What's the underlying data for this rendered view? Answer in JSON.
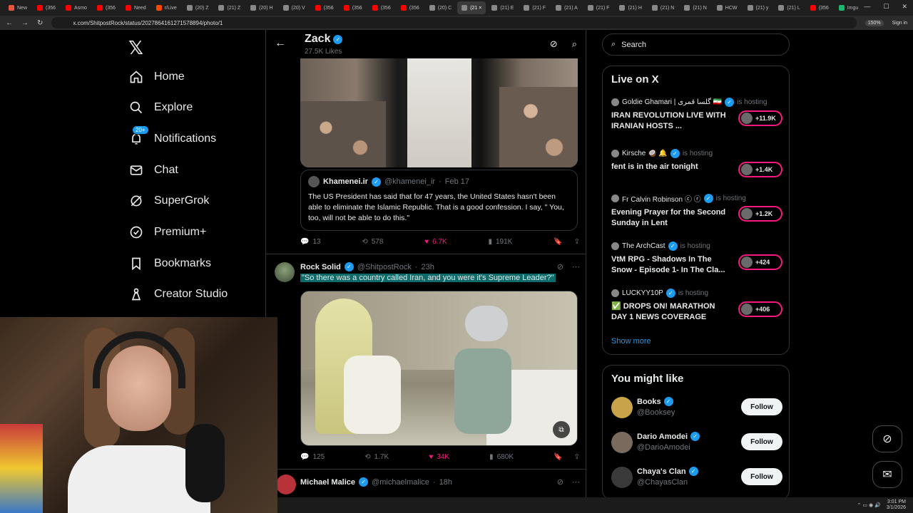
{
  "browser": {
    "tabs": [
      {
        "label": "New",
        "color": "#e8553a"
      },
      {
        "label": "(356",
        "color": "#ff0000"
      },
      {
        "label": "Asmo",
        "color": "#ff0000"
      },
      {
        "label": "(356",
        "color": "#ff0000"
      },
      {
        "label": "Need",
        "color": "#ff0000"
      },
      {
        "label": "r/Live",
        "color": "#ff4500"
      },
      {
        "label": "(20) Z",
        "color": "#888888"
      },
      {
        "label": "(21) Z",
        "color": "#888888"
      },
      {
        "label": "(20) H",
        "color": "#888888"
      },
      {
        "label": "(20) V",
        "color": "#888888"
      },
      {
        "label": "(356",
        "color": "#ff0000"
      },
      {
        "label": "(356",
        "color": "#ff0000"
      },
      {
        "label": "(356",
        "color": "#ff0000"
      },
      {
        "label": "(356",
        "color": "#ff0000"
      },
      {
        "label": "(20) C",
        "color": "#888888"
      },
      {
        "label": "(21 ×",
        "color": "#888888",
        "active": true
      },
      {
        "label": "(21) E",
        "color": "#888888"
      },
      {
        "label": "(21) F",
        "color": "#888888"
      },
      {
        "label": "(21) A",
        "color": "#888888"
      },
      {
        "label": "(21) F",
        "color": "#888888"
      },
      {
        "label": "(21) H",
        "color": "#888888"
      },
      {
        "label": "(21) N",
        "color": "#888888"
      },
      {
        "label": "(21) N",
        "color": "#888888"
      },
      {
        "label": "HCW",
        "color": "#888888"
      },
      {
        "label": "(21) y",
        "color": "#888888"
      },
      {
        "label": "(21) L",
        "color": "#888888"
      },
      {
        "label": "(356",
        "color": "#ff0000"
      },
      {
        "label": "Imgu",
        "color": "#1bb76e"
      }
    ],
    "url": "x.com/ShitpostRock/status/2027864161271578894/photo/1",
    "zoom": "150%",
    "signin": "Sign in"
  },
  "nav": {
    "items": [
      {
        "label": "Home",
        "icon": "home-icon"
      },
      {
        "label": "Explore",
        "icon": "search-icon"
      },
      {
        "label": "Notifications",
        "icon": "bell-icon",
        "badge": "20+"
      },
      {
        "label": "Chat",
        "icon": "mail-icon"
      },
      {
        "label": "SuperGrok",
        "icon": "grok-icon"
      },
      {
        "label": "Premium+",
        "icon": "premium-icon"
      },
      {
        "label": "Bookmarks",
        "icon": "bookmark-icon"
      },
      {
        "label": "Creator Studio",
        "icon": "creator-icon"
      }
    ]
  },
  "header": {
    "name": "Zack",
    "likes": "27.5K Likes"
  },
  "quote": {
    "name": "Khamenei.ir",
    "handle": "@khamenei_ir",
    "date": "Feb 17",
    "text": "The US President has said that for 47 years, the United States hasn't been able to eliminate the Islamic Republic. That is a good confession. I say, \" You, too, will not be able to do this.\""
  },
  "post1_actions": {
    "replies": "13",
    "reposts": "578",
    "likes": "6.7K",
    "views": "191K"
  },
  "post2": {
    "name": "Rock Solid",
    "handle": "@ShitpostRock",
    "time": "23h",
    "text": "\"So there was a country called Iran, and you were it's Supreme Leader?\""
  },
  "post2_actions": {
    "replies": "125",
    "reposts": "1.7K",
    "likes": "34K",
    "views": "680K"
  },
  "post3": {
    "name": "Michael Malice",
    "handle": "@michaelmalice",
    "time": "18h"
  },
  "search": {
    "placeholder": "Search"
  },
  "live": {
    "title": "Live on X",
    "items": [
      {
        "host": "Goldie Ghamari | گلسا قمری 🇮🇷",
        "hosting": "is hosting",
        "title": "IRAN REVOLUTION LIVE WITH IRANIAN HOSTS ...",
        "count": "+11.9K"
      },
      {
        "host": "Kirsche 🥥 🔔",
        "hosting": "is hosting",
        "title": "fent is in the air tonight",
        "count": "+1.4K"
      },
      {
        "host": "Fr Calvin Robinson ⓒ ⓡ",
        "hosting": "is hosting",
        "title": "Evening Prayer for the Second Sunday in Lent",
        "count": "+1.2K"
      },
      {
        "host": "The ArchCast",
        "hosting": "is hosting",
        "title": "VtM RPG - Shadows In The Snow - Episode 1- In The Cla...",
        "count": "+424"
      },
      {
        "host": "LUCKYY10P",
        "hosting": "is hosting",
        "title": "✅ DROPS ON! MARATHON DAY 1 NEWS COVERAGE",
        "count": "+406"
      }
    ],
    "show_more": "Show more"
  },
  "suggest": {
    "title": "You might like",
    "items": [
      {
        "name": "Books",
        "handle": "@Booksey",
        "button": "Follow",
        "color": "#c9a34a"
      },
      {
        "name": "Dario Amodei",
        "handle": "@DarioAmodei",
        "button": "Follow",
        "color": "#7a6a5e"
      },
      {
        "name": "Chaya's Clan",
        "handle": "@ChayasClan",
        "button": "Follow",
        "color": "#3a3a3a"
      }
    ]
  },
  "taskbar": {
    "time": "3:01 PM",
    "date": "3/1/2026"
  }
}
